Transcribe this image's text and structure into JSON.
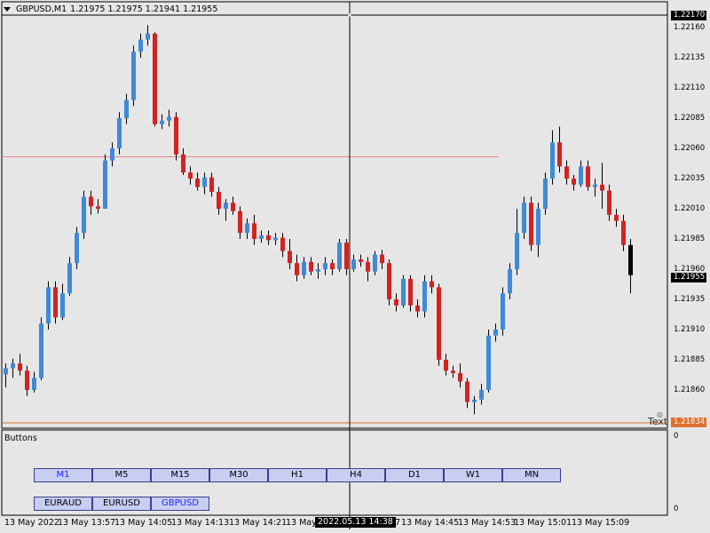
{
  "header": {
    "symbol": "GBPUSD,M1",
    "ohlc": "1.21975 1.21975 1.21941 1.21955"
  },
  "subwindow": {
    "label": "Buttons",
    "scale_top": "0",
    "scale_bottom": "0"
  },
  "timeframe_buttons": [
    "M1",
    "M5",
    "M15",
    "M30",
    "H1",
    "H4",
    "D1",
    "W1",
    "MN"
  ],
  "active_timeframe": "M1",
  "symbol_buttons": [
    "EURAUD",
    "EURUSD",
    "GBPUSD"
  ],
  "active_symbol": "GBPUSD",
  "price_axis": {
    "ticks": [
      "1.22160",
      "1.22135",
      "1.22110",
      "1.22085",
      "1.22060",
      "1.22035",
      "1.22010",
      "1.21985",
      "1.21960",
      "1.21935",
      "1.21910",
      "1.21885",
      "1.21860"
    ],
    "top_label": "1.22170",
    "bid_label": "1.21955",
    "low_line_label": "1.21834"
  },
  "time_axis": {
    "ticks": [
      "13 May 2022",
      "13 May 13:57",
      "13 May 14:05",
      "13 May 14:13",
      "13 May 14:21",
      "13 May 14:29",
      "13 May 14:37",
      "13 May 14:45",
      "13 May 14:53",
      "13 May 15:01",
      "13 May 15:09"
    ],
    "crosshair_label": "2022.05.13 14:38"
  },
  "text_object": "Text",
  "colors": {
    "up": "#3f8ad8",
    "down": "#d42222",
    "background": "#e6e6e6",
    "grid_line": "#e88",
    "low_line": "#e07030"
  },
  "chart_data": {
    "type": "candlestick",
    "timeframe": "M1",
    "candles": [
      {
        "o": 1.21873,
        "h": 1.21882,
        "l": 1.21862,
        "c": 1.21878
      },
      {
        "o": 1.21878,
        "h": 1.21886,
        "l": 1.2187,
        "c": 1.21882
      },
      {
        "o": 1.21882,
        "h": 1.2189,
        "l": 1.21872,
        "c": 1.21876
      },
      {
        "o": 1.21876,
        "h": 1.2188,
        "l": 1.21855,
        "c": 1.2186
      },
      {
        "o": 1.2186,
        "h": 1.21875,
        "l": 1.21858,
        "c": 1.2187
      },
      {
        "o": 1.2187,
        "h": 1.2192,
        "l": 1.21868,
        "c": 1.21915
      },
      {
        "o": 1.21915,
        "h": 1.2195,
        "l": 1.2191,
        "c": 1.21945
      },
      {
        "o": 1.21945,
        "h": 1.2195,
        "l": 1.21915,
        "c": 1.2192
      },
      {
        "o": 1.2192,
        "h": 1.21948,
        "l": 1.21918,
        "c": 1.2194
      },
      {
        "o": 1.2194,
        "h": 1.2197,
        "l": 1.21938,
        "c": 1.21965
      },
      {
        "o": 1.21965,
        "h": 1.21995,
        "l": 1.2196,
        "c": 1.2199
      },
      {
        "o": 1.2199,
        "h": 1.22025,
        "l": 1.21985,
        "c": 1.2202
      },
      {
        "o": 1.2202,
        "h": 1.22025,
        "l": 1.22005,
        "c": 1.22012
      },
      {
        "o": 1.22012,
        "h": 1.22018,
        "l": 1.22006,
        "c": 1.2201
      },
      {
        "o": 1.2201,
        "h": 1.22055,
        "l": 1.2201,
        "c": 1.2205
      },
      {
        "o": 1.2205,
        "h": 1.22065,
        "l": 1.22045,
        "c": 1.2206
      },
      {
        "o": 1.2206,
        "h": 1.2209,
        "l": 1.22055,
        "c": 1.22085
      },
      {
        "o": 1.22085,
        "h": 1.22105,
        "l": 1.2208,
        "c": 1.221
      },
      {
        "o": 1.221,
        "h": 1.22145,
        "l": 1.22095,
        "c": 1.2214
      },
      {
        "o": 1.2214,
        "h": 1.22155,
        "l": 1.22135,
        "c": 1.2215
      },
      {
        "o": 1.2215,
        "h": 1.22162,
        "l": 1.22145,
        "c": 1.22155
      },
      {
        "o": 1.22155,
        "h": 1.22156,
        "l": 1.22078,
        "c": 1.2208
      },
      {
        "o": 1.2208,
        "h": 1.22088,
        "l": 1.22076,
        "c": 1.22083
      },
      {
        "o": 1.22083,
        "h": 1.22092,
        "l": 1.22078,
        "c": 1.22086
      },
      {
        "o": 1.22086,
        "h": 1.2209,
        "l": 1.2205,
        "c": 1.22055
      },
      {
        "o": 1.22055,
        "h": 1.2206,
        "l": 1.22038,
        "c": 1.2204
      },
      {
        "o": 1.2204,
        "h": 1.22045,
        "l": 1.2203,
        "c": 1.22035
      },
      {
        "o": 1.22035,
        "h": 1.2204,
        "l": 1.22025,
        "c": 1.22028
      },
      {
        "o": 1.22028,
        "h": 1.2204,
        "l": 1.22022,
        "c": 1.22036
      },
      {
        "o": 1.22036,
        "h": 1.2204,
        "l": 1.2202,
        "c": 1.22024
      },
      {
        "o": 1.22024,
        "h": 1.22028,
        "l": 1.22005,
        "c": 1.2201
      },
      {
        "o": 1.2201,
        "h": 1.22018,
        "l": 1.22,
        "c": 1.22015
      },
      {
        "o": 1.22015,
        "h": 1.2202,
        "l": 1.22005,
        "c": 1.22008
      },
      {
        "o": 1.22008,
        "h": 1.22012,
        "l": 1.21985,
        "c": 1.2199
      },
      {
        "o": 1.2199,
        "h": 1.22002,
        "l": 1.21985,
        "c": 1.21998
      },
      {
        "o": 1.21998,
        "h": 1.22005,
        "l": 1.2198,
        "c": 1.21985
      },
      {
        "o": 1.21985,
        "h": 1.21992,
        "l": 1.21982,
        "c": 1.21988
      },
      {
        "o": 1.21988,
        "h": 1.21992,
        "l": 1.2198,
        "c": 1.21984
      },
      {
        "o": 1.21984,
        "h": 1.2199,
        "l": 1.2198,
        "c": 1.21986
      },
      {
        "o": 1.21986,
        "h": 1.2199,
        "l": 1.2197,
        "c": 1.21975
      },
      {
        "o": 1.21975,
        "h": 1.21985,
        "l": 1.2196,
        "c": 1.21965
      },
      {
        "o": 1.21965,
        "h": 1.21972,
        "l": 1.2195,
        "c": 1.21955
      },
      {
        "o": 1.21955,
        "h": 1.2197,
        "l": 1.21952,
        "c": 1.21966
      },
      {
        "o": 1.21966,
        "h": 1.2197,
        "l": 1.21955,
        "c": 1.21958
      },
      {
        "o": 1.21958,
        "h": 1.21965,
        "l": 1.21952,
        "c": 1.2196
      },
      {
        "o": 1.2196,
        "h": 1.2197,
        "l": 1.21955,
        "c": 1.21965
      },
      {
        "o": 1.21965,
        "h": 1.21968,
        "l": 1.21955,
        "c": 1.2196
      },
      {
        "o": 1.2196,
        "h": 1.21985,
        "l": 1.21958,
        "c": 1.21982
      },
      {
        "o": 1.21982,
        "h": 1.21985,
        "l": 1.21955,
        "c": 1.2196
      },
      {
        "o": 1.2196,
        "h": 1.21972,
        "l": 1.21958,
        "c": 1.21968
      },
      {
        "o": 1.21968,
        "h": 1.21972,
        "l": 1.21962,
        "c": 1.21966
      },
      {
        "o": 1.21966,
        "h": 1.2197,
        "l": 1.2195,
        "c": 1.21958
      },
      {
        "o": 1.21958,
        "h": 1.21975,
        "l": 1.21955,
        "c": 1.21972
      },
      {
        "o": 1.21972,
        "h": 1.21976,
        "l": 1.2196,
        "c": 1.21965
      },
      {
        "o": 1.21965,
        "h": 1.21968,
        "l": 1.2193,
        "c": 1.21935
      },
      {
        "o": 1.21935,
        "h": 1.2194,
        "l": 1.21925,
        "c": 1.2193
      },
      {
        "o": 1.2193,
        "h": 1.21955,
        "l": 1.21928,
        "c": 1.21952
      },
      {
        "o": 1.21952,
        "h": 1.21955,
        "l": 1.21925,
        "c": 1.2193
      },
      {
        "o": 1.2193,
        "h": 1.21935,
        "l": 1.2192,
        "c": 1.21925
      },
      {
        "o": 1.21925,
        "h": 1.21955,
        "l": 1.2192,
        "c": 1.2195
      },
      {
        "o": 1.2195,
        "h": 1.21955,
        "l": 1.2194,
        "c": 1.21945
      },
      {
        "o": 1.21945,
        "h": 1.21948,
        "l": 1.2188,
        "c": 1.21885
      },
      {
        "o": 1.21885,
        "h": 1.2189,
        "l": 1.21872,
        "c": 1.21876
      },
      {
        "o": 1.21876,
        "h": 1.2188,
        "l": 1.2187,
        "c": 1.21874
      },
      {
        "o": 1.21874,
        "h": 1.21882,
        "l": 1.21862,
        "c": 1.21867
      },
      {
        "o": 1.21867,
        "h": 1.2187,
        "l": 1.21845,
        "c": 1.2185
      },
      {
        "o": 1.2185,
        "h": 1.21855,
        "l": 1.2184,
        "c": 1.21852
      },
      {
        "o": 1.21852,
        "h": 1.21865,
        "l": 1.21848,
        "c": 1.2186
      },
      {
        "o": 1.2186,
        "h": 1.2191,
        "l": 1.21858,
        "c": 1.21905
      },
      {
        "o": 1.21905,
        "h": 1.21915,
        "l": 1.219,
        "c": 1.2191
      },
      {
        "o": 1.2191,
        "h": 1.21945,
        "l": 1.21905,
        "c": 1.2194
      },
      {
        "o": 1.2194,
        "h": 1.21965,
        "l": 1.21935,
        "c": 1.2196
      },
      {
        "o": 1.2196,
        "h": 1.2201,
        "l": 1.21955,
        "c": 1.2199
      },
      {
        "o": 1.2199,
        "h": 1.2202,
        "l": 1.21985,
        "c": 1.22015
      },
      {
        "o": 1.22015,
        "h": 1.2202,
        "l": 1.21975,
        "c": 1.2198
      },
      {
        "o": 1.2198,
        "h": 1.22015,
        "l": 1.2197,
        "c": 1.2201
      },
      {
        "o": 1.2201,
        "h": 1.2204,
        "l": 1.22005,
        "c": 1.22035
      },
      {
        "o": 1.22035,
        "h": 1.22075,
        "l": 1.2203,
        "c": 1.22065
      },
      {
        "o": 1.22065,
        "h": 1.22078,
        "l": 1.2204,
        "c": 1.22045
      },
      {
        "o": 1.22045,
        "h": 1.2205,
        "l": 1.2203,
        "c": 1.22035
      },
      {
        "o": 1.22035,
        "h": 1.22038,
        "l": 1.22025,
        "c": 1.2203
      },
      {
        "o": 1.2203,
        "h": 1.2205,
        "l": 1.22028,
        "c": 1.22045
      },
      {
        "o": 1.22045,
        "h": 1.2205,
        "l": 1.22025,
        "c": 1.22028
      },
      {
        "o": 1.22028,
        "h": 1.22035,
        "l": 1.2202,
        "c": 1.2203
      },
      {
        "o": 1.2203,
        "h": 1.22048,
        "l": 1.2201,
        "c": 1.22025
      },
      {
        "o": 1.22025,
        "h": 1.2203,
        "l": 1.22,
        "c": 1.22005
      },
      {
        "o": 1.22005,
        "h": 1.2201,
        "l": 1.21995,
        "c": 1.22
      },
      {
        "o": 1.22,
        "h": 1.22005,
        "l": 1.21975,
        "c": 1.2198
      },
      {
        "o": 1.2198,
        "h": 1.21985,
        "l": 1.2194,
        "c": 1.21955
      }
    ],
    "price_range": [
      1.21834,
      1.22178
    ],
    "horizontal_lines": [
      1.22053,
      1.21834
    ],
    "crosshair_time": "2022.05.13 14:38"
  }
}
